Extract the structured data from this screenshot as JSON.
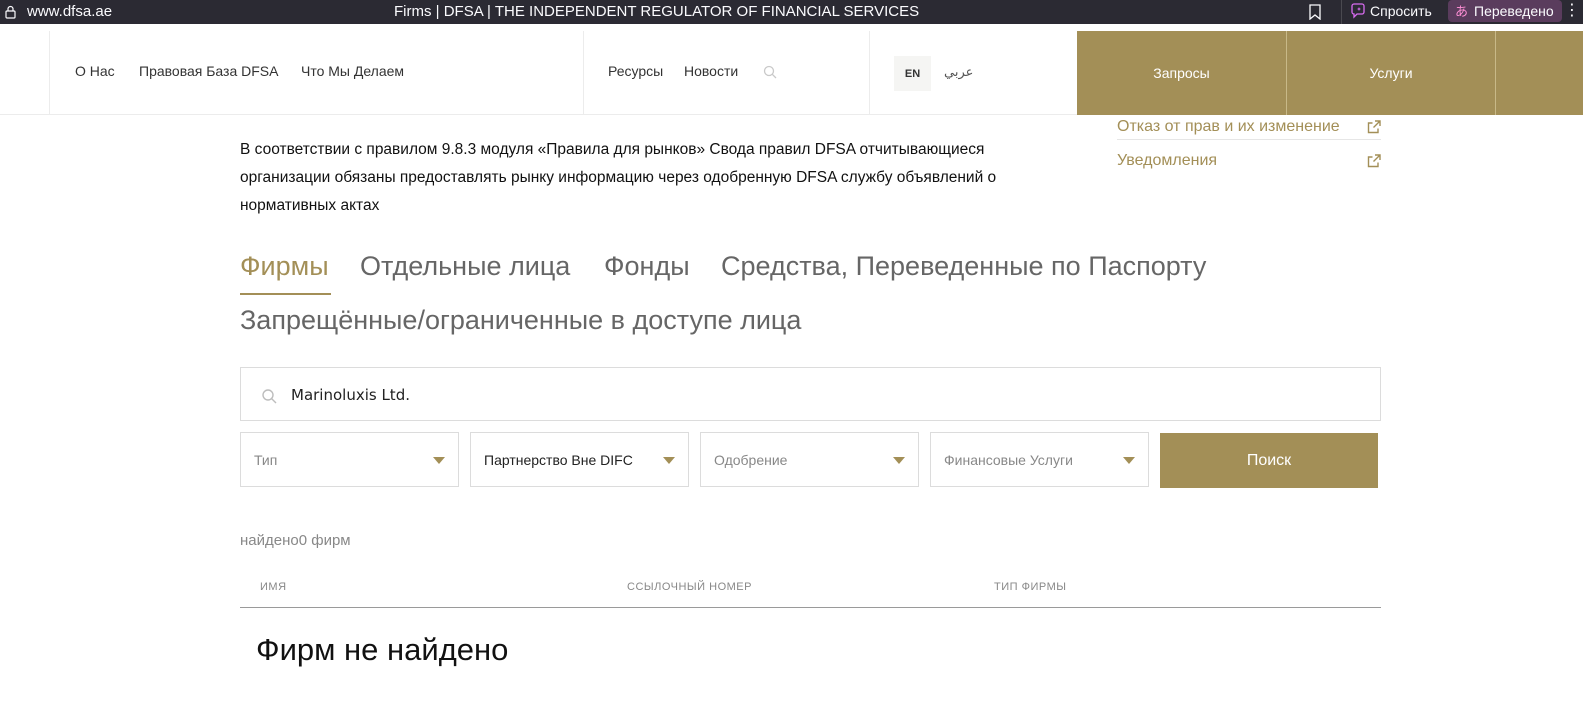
{
  "browser": {
    "url": "www.dfsa.ae",
    "title": "Firms | DFSA | THE INDEPENDENT REGULATOR OF FINANCIAL SERVICES",
    "ask_label": "Спросить",
    "translated_label": "Переведено",
    "more_glyph": "⋮"
  },
  "header": {
    "nav_left": [
      "О Нас",
      "Правовая База DFSA",
      "Что Мы Делаем"
    ],
    "nav_mid": [
      "Ресурсы",
      "Новости"
    ],
    "lang_en": "EN",
    "lang_ar": "عربي",
    "btn_requests": "Запросы",
    "btn_services": "Услуги"
  },
  "side_links": [
    {
      "label": "Отказ от прав и их изменение",
      "icon": "external-link-icon"
    },
    {
      "label": "Уведомления",
      "icon": "external-link-icon"
    }
  ],
  "intro_text": "В соответствии с правилом 9.8.3 модуля «Правила для рынков» Свода правил DFSA отчитывающиеся организации обязаны предоставлять рынку информацию через одобренную DFSA службу объявлений о нормативных актах",
  "tabs": [
    {
      "label": "Фирмы",
      "active": true
    },
    {
      "label": "Отдельные лица",
      "active": false
    },
    {
      "label": "Фонды",
      "active": false
    },
    {
      "label": "Средства, Переведенные по Паспорту",
      "active": false
    },
    {
      "label": "Запрещённые/ограниченные в доступе лица",
      "active": false
    }
  ],
  "search": {
    "value": "Marinoluxis Ltd.",
    "icon": "search-icon"
  },
  "filters": [
    {
      "label": "Тип",
      "selected": false
    },
    {
      "label": "Партнерство Вне DIFC",
      "selected": true
    },
    {
      "label": "Одобрение",
      "selected": false
    },
    {
      "label": "Финансовые Услуги",
      "selected": false
    }
  ],
  "search_button": "Поиск",
  "results": {
    "found_text": "найдено0 фирм",
    "columns": [
      "ИМЯ",
      "ССЫЛОЧНЫЙ НОМЕР",
      "ТИП ФИРМЫ"
    ],
    "empty_text": "Фирм не найдено"
  },
  "colors": {
    "accent": "#a38f57",
    "browser_bg": "#2b2a33"
  }
}
